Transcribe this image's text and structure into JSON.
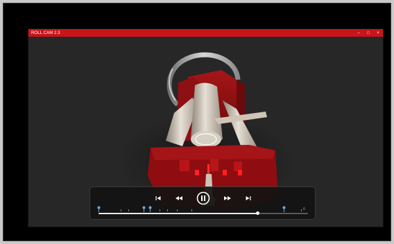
{
  "window": {
    "title": "ROLL CAM 2.3",
    "minimize_glyph": "–",
    "maximize_glyph": "□",
    "close_glyph": "×",
    "titlebar_color": "#c8151b"
  },
  "player": {
    "progress": 0.76,
    "buttons": [
      "skip-back-icon",
      "rewind-icon",
      "pause-icon",
      "fast-forward-icon",
      "skip-forward-icon"
    ],
    "end_label": "0",
    "accent": "#6fa8dc"
  }
}
